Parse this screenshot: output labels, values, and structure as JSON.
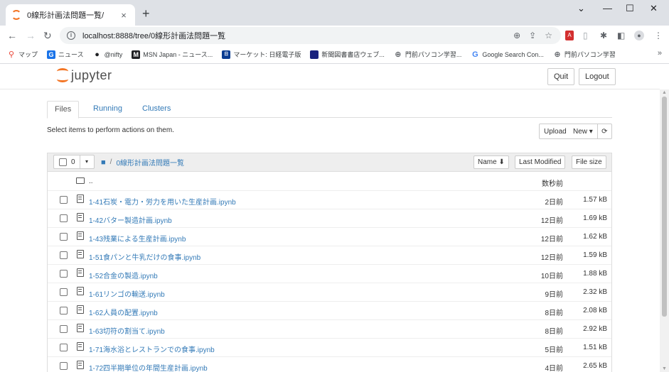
{
  "browser": {
    "tab_title": "0線形計画法問題一覧/",
    "tab_close": "×",
    "new_tab": "+",
    "window_controls": {
      "minimize": "—",
      "restore": "☐",
      "close": "✕",
      "dropdown": "⌄"
    },
    "url": "localhost:8888/tree/0線形計画法問題一覧",
    "bookmarks": [
      {
        "label": "マップ",
        "icon": "map-pin-icon",
        "color": "#ea4335"
      },
      {
        "label": "ニュース",
        "icon": "news-icon",
        "color": "#1a73e8"
      },
      {
        "label": "@nifty",
        "icon": "nifty-icon",
        "color": "#202124"
      },
      {
        "label": "MSN Japan - ニュース...",
        "icon": "msn-icon",
        "color": "#202124"
      },
      {
        "label": "マーケット: 日経電子版",
        "icon": "nikkei-icon",
        "color": "#0b3d91"
      },
      {
        "label": "新聞図書書店ウェブ...",
        "icon": "bookmark-icon",
        "color": "#1a237e"
      },
      {
        "label": "門前パソコン学習...",
        "icon": "globe-icon",
        "color": "#5f6368"
      },
      {
        "label": "Google Search Con...",
        "icon": "google-icon",
        "color": "#4285f4"
      },
      {
        "label": "門前パソコン学習",
        "icon": "globe-icon",
        "color": "#5f6368"
      }
    ],
    "bookmarks_more": "»"
  },
  "jupyter": {
    "logo_text": "jupyter",
    "quit_label": "Quit",
    "logout_label": "Logout",
    "tabs": [
      {
        "label": "Files",
        "active": true
      },
      {
        "label": "Running",
        "active": false
      },
      {
        "label": "Clusters",
        "active": false
      }
    ],
    "select_hint": "Select items to perform actions on them.",
    "upload_label": "Upload",
    "new_label": "New ▾",
    "refresh_icon": "⟳",
    "header": {
      "selected_count": "0",
      "caret": "▾",
      "root_sep": "/",
      "folder": "0線形計画法問題一覧",
      "name_sort": "Name ⬇",
      "last_modified_sort": "Last Modified",
      "file_size_sort": "File size"
    },
    "parent_row": {
      "name": "..",
      "modified": "数秒前"
    },
    "files": [
      {
        "name": "1-41石炭・電力・労力を用いた生産計画.ipynb",
        "modified": "2日前",
        "size": "1.57 kB"
      },
      {
        "name": "1-42バター製造計画.ipynb",
        "modified": "12日前",
        "size": "1.69 kB"
      },
      {
        "name": "1-43残業による生産計画.ipynb",
        "modified": "12日前",
        "size": "1.62 kB"
      },
      {
        "name": "1-51食パンと牛乳だけの食事.ipynb",
        "modified": "12日前",
        "size": "1.59 kB"
      },
      {
        "name": "1-52合金の製造.ipynb",
        "modified": "10日前",
        "size": "1.88 kB"
      },
      {
        "name": "1-61リンゴの輸送.ipynb",
        "modified": "9日前",
        "size": "2.32 kB"
      },
      {
        "name": "1-62人員の配置.ipynb",
        "modified": "8日前",
        "size": "2.08 kB"
      },
      {
        "name": "1-63切符の割当て.ipynb",
        "modified": "8日前",
        "size": "2.92 kB"
      },
      {
        "name": "1-71海水浴とレストランでの食事.ipynb",
        "modified": "5日前",
        "size": "1.51 kB"
      },
      {
        "name": "1-72四半期単位の年間生産計画.ipynb",
        "modified": "4日前",
        "size": "2.65 kB"
      }
    ]
  }
}
